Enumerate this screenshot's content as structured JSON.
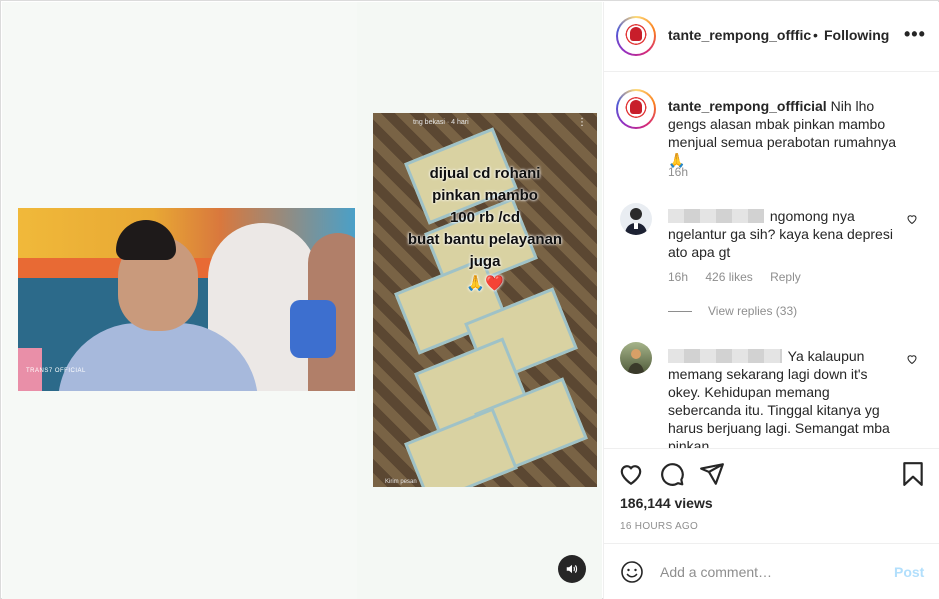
{
  "post": {
    "author": "tante_rempong_offficial",
    "separator": "•",
    "follow_status": "Following",
    "more_icon": "more-options-icon",
    "more_label": "•••"
  },
  "media": {
    "tv_logo": "TRANS7 OFFICIAL",
    "story_text_lines": [
      "dijual cd rohani",
      "pinkan mambo",
      "100 rb /cd",
      "buat bantu pelayanan",
      "juga",
      "🙏❤️"
    ],
    "story_top": "tng bekasi · 4 hari",
    "story_menu": "⋮",
    "story_bottom": "Kirim pesan",
    "audio_icon": "speaker-icon"
  },
  "caption": {
    "username": "tante_rempong_offficial",
    "text": "Nih lho gengs alasan mbak pinkan mambo menjual semua perabotan rumahnya 🙏",
    "time": "16h"
  },
  "comments": [
    {
      "text": "ngomong nya ngelantur ga sih? kaya kena depresi ato apa gt",
      "time": "16h",
      "likes": "426 likes",
      "reply": "Reply",
      "view_replies": "View replies (33)"
    },
    {
      "text": "Ya kalaupun memang sekarang lagi down it's okey. Kehidupan memang sebercanda itu. Tinggal kitanya yg harus berjuang lagi. Semangat mba pinkan"
    }
  ],
  "stats": {
    "views": "186,144 views",
    "time_ago": "16 HOURS AGO"
  },
  "composer": {
    "placeholder": "Add a comment…",
    "post_label": "Post"
  },
  "colors": {
    "accent": "#0095f6",
    "post_disabled": "#b2dffc",
    "text_secondary": "#8e8e8e"
  }
}
